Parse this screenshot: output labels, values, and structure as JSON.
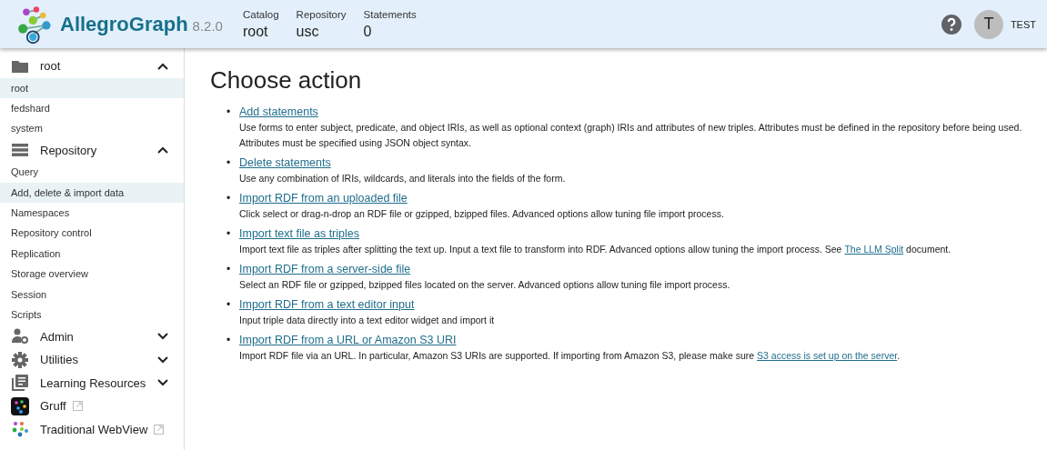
{
  "header": {
    "app_name": "AllegroGraph",
    "version": "8.2.0",
    "stats": [
      {
        "label": "Catalog",
        "value": "root"
      },
      {
        "label": "Repository",
        "value": "usc"
      },
      {
        "label": "Statements",
        "value": "0"
      }
    ],
    "avatar_letter": "T",
    "user": "TEST"
  },
  "sidebar": [
    {
      "kind": "section",
      "label": "root",
      "expanded": true,
      "children": [
        {
          "label": "root",
          "selected": true
        },
        {
          "label": "fedshard",
          "selected": false
        },
        {
          "label": "system",
          "selected": false
        }
      ]
    },
    {
      "kind": "section",
      "label": "Repository",
      "expanded": true,
      "children": [
        {
          "label": "Query",
          "selected": false
        },
        {
          "label": "Add, delete & import data",
          "selected": true
        },
        {
          "label": "Namespaces",
          "selected": false
        },
        {
          "label": "Repository control",
          "selected": false
        },
        {
          "label": "Replication",
          "selected": false
        },
        {
          "label": "Storage overview",
          "selected": false
        },
        {
          "label": "Session",
          "selected": false
        },
        {
          "label": "Scripts",
          "selected": false
        }
      ]
    },
    {
      "kind": "section",
      "label": "Admin",
      "expanded": false
    },
    {
      "kind": "section",
      "label": "Utilities",
      "expanded": false
    },
    {
      "kind": "section",
      "label": "Learning Resources",
      "expanded": false
    },
    {
      "kind": "external",
      "label": "Gruff"
    },
    {
      "kind": "external",
      "label": "Traditional WebView"
    }
  ],
  "main": {
    "title": "Choose action",
    "actions": [
      {
        "bullet": "•",
        "link": "Add statements",
        "desc": "Use forms to enter subject, predicate, and object IRIs, as well as optional context (graph) IRIs and attributes of new triples. Attributes must be defined in the repository before being used. Attributes must be specified using JSON object syntax."
      },
      {
        "bullet": "•",
        "link": "Delete statements",
        "desc": "Use any combination of IRIs, wildcards, and literals into the fields of the form."
      },
      {
        "bullet": "•",
        "link": "Import RDF from an uploaded file",
        "desc": "Click select or drag-n-drop an RDF file or gzipped, bzipped files. Advanced options allow tuning file import process."
      },
      {
        "bullet": "•",
        "link": "Import text file as triples",
        "desc": "Import text file as triples after splitting the text up. Input a text file to transform into RDF. Advanced options allow tuning the import process. See",
        "desc_link": "The LLM Split",
        "desc_after": " document."
      },
      {
        "bullet": "•",
        "link": "Import RDF from a server-side file",
        "desc": "Select an RDF file or gzipped, bzipped files located on the server. Advanced options allow tuning file import process."
      },
      {
        "bullet": "•",
        "link": "Import RDF from a text editor input",
        "desc": "Input triple data directly into a text editor widget and import it"
      },
      {
        "bullet": "•",
        "link": "Import RDF from a URL or Amazon S3 URI",
        "desc": "Import RDF file via an URL. In particular, Amazon S3 URIs are supported. If importing from Amazon S3, please make sure",
        "desc_link": "S3 access is set up on the server",
        "desc_after": "."
      }
    ]
  }
}
